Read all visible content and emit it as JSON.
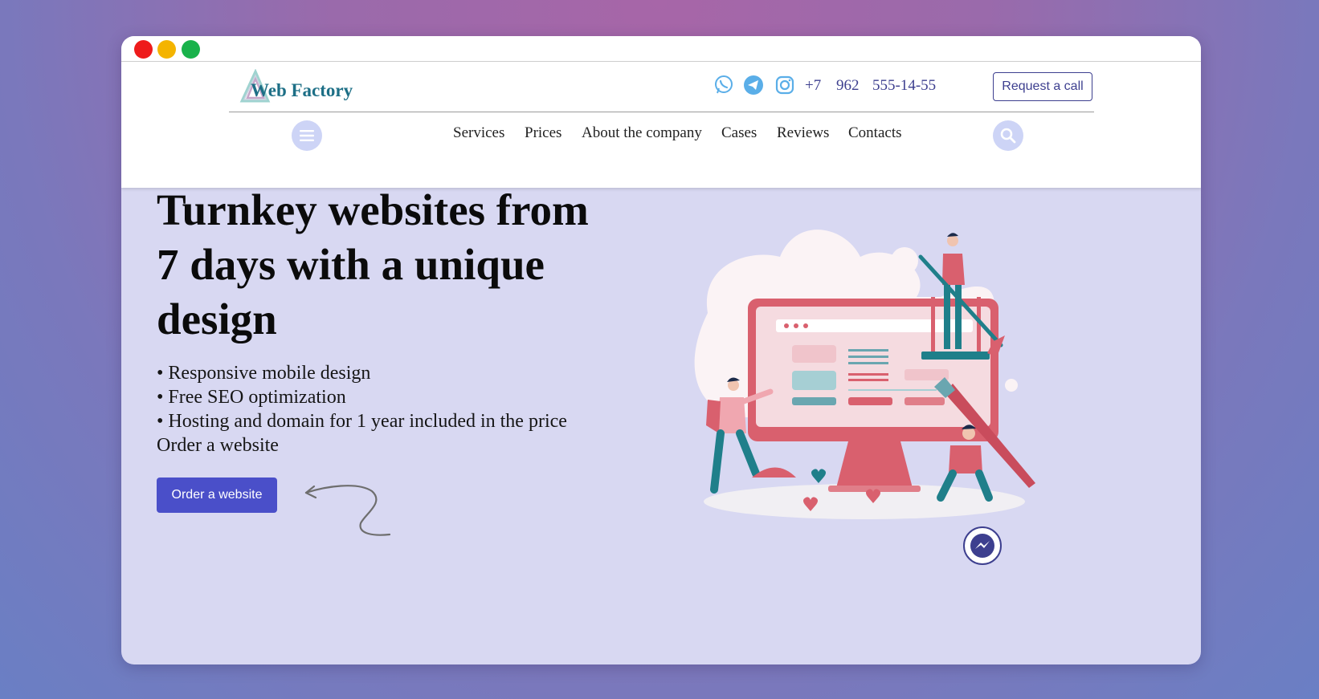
{
  "window": {
    "traffic_lights": [
      "close",
      "minimize",
      "maximize"
    ]
  },
  "header": {
    "logo_text": "Web Factory",
    "social_icons": [
      "whatsapp-icon",
      "telegram-icon",
      "instagram-icon"
    ],
    "phone": {
      "code": "+7",
      "area": "962",
      "number": "555-14-55"
    },
    "request_call_label": "Request a call",
    "nav": [
      "Services",
      "Prices",
      "About the company",
      "Cases",
      "Reviews",
      "Contacts"
    ],
    "menu_icon": "menu-icon",
    "search_icon": "search-icon"
  },
  "hero": {
    "title_lines": [
      "Turnkey websites from",
      "7 days with a unique",
      "design"
    ],
    "bullets": [
      "• Responsive mobile design",
      "• Free SEO optimization",
      "• Hosting and domain for 1 year included in the price"
    ],
    "subtext": "Order a website",
    "order_button_label": "Order a website"
  },
  "floating": {
    "messenger_icon": "messenger-icon"
  },
  "colors": {
    "accent": "#4a4fc9",
    "brand_text": "#3d3f8f",
    "hero_bg": "#d8d8f2",
    "illustration_red": "#d9606e",
    "illustration_teal": "#1f7f8a"
  }
}
